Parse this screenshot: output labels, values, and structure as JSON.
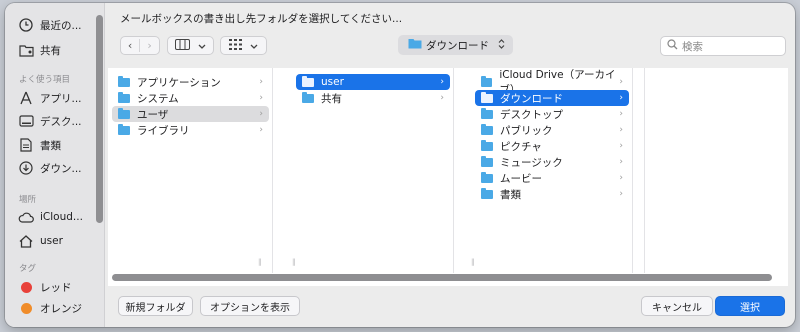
{
  "title": "メールボックスの書き出し先フォルダを選択してください...",
  "sidebar": {
    "favorites": [
      {
        "label": "最近の...",
        "icon": "clock-icon"
      },
      {
        "label": "共有",
        "icon": "shared-folder-icon"
      }
    ],
    "section_often": "よく使う項目",
    "often": [
      {
        "label": "アプリ...",
        "icon": "applications-icon"
      },
      {
        "label": "デスク...",
        "icon": "desktop-icon"
      },
      {
        "label": "書類",
        "icon": "document-icon"
      },
      {
        "label": "ダウン...",
        "icon": "download-icon"
      }
    ],
    "section_places": "場所",
    "places": [
      {
        "label": "iCloud...",
        "icon": "cloud-icon"
      },
      {
        "label": "user",
        "icon": "home-icon"
      }
    ],
    "section_tags": "タグ",
    "tags": [
      {
        "label": "レッド",
        "color": "#e8413a"
      },
      {
        "label": "オレンジ",
        "color": "#f08c2a"
      }
    ]
  },
  "toolbar": {
    "back": "‹",
    "forward": "›",
    "location": "ダウンロード",
    "search_placeholder": "検索"
  },
  "columns": [
    [
      "アプリケーション",
      "システム",
      "ユーザ",
      "ライブラリ"
    ],
    [
      "user",
      "共有"
    ],
    [
      "iCloud Drive（アーカイブ）",
      "ダウンロード",
      "デスクトップ",
      "パブリック",
      "ピクチャ",
      "ミュージック",
      "ムービー",
      "書類"
    ]
  ],
  "buttons": {
    "new_folder": "新規フォルダ",
    "show_options": "オプションを表示",
    "cancel": "キャンセル",
    "select": "選択"
  },
  "colors": {
    "accent": "#1a73e8",
    "folder": "#4aa9e6"
  }
}
